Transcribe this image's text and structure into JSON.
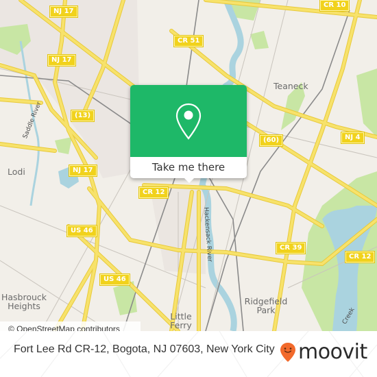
{
  "map": {
    "road_shields": [
      {
        "id": "nj17-top",
        "label": "NJ 17"
      },
      {
        "id": "nj17-mid",
        "label": "NJ 17"
      },
      {
        "id": "cr51",
        "label": "CR 51"
      },
      {
        "id": "cr10",
        "label": "CR 10"
      },
      {
        "id": "r13",
        "label": "(13)"
      },
      {
        "id": "r60",
        "label": "(60)"
      },
      {
        "id": "nj4",
        "label": "NJ 4"
      },
      {
        "id": "nj17-low",
        "label": "NJ 17"
      },
      {
        "id": "cr12-left",
        "label": "CR 12"
      },
      {
        "id": "us46-top",
        "label": "US 46"
      },
      {
        "id": "cr39",
        "label": "CR 39"
      },
      {
        "id": "cr12-right",
        "label": "CR 12"
      },
      {
        "id": "us46-bottom",
        "label": "US 46"
      }
    ],
    "places": {
      "teaneck": "Teaneck",
      "lodi": "Lodi",
      "hasbrouck_heights": "Hasbrouck\nHeights",
      "ridgefield_park": "Ridgefield\nPark",
      "little_ferry": "Little\nFerry"
    },
    "rivers": {
      "saddle_river": "Saddle River",
      "hackensack_river": "Hackensack River",
      "creek": "Creek"
    },
    "colors": {
      "land": "#f2efe9",
      "road": "#f7e26b",
      "road_outline": "#e8c93a",
      "water": "#aad3df",
      "park": "#c8e6a4",
      "popup_green": "#1eb868",
      "moovit_orange": "#f26a2c"
    }
  },
  "popup": {
    "icon": "map-pin-icon",
    "action_label": "Take me there"
  },
  "attribution": "© OpenStreetMap contributors",
  "footer": {
    "address": "Fort Lee Rd CR-12, Bogota, NJ 07603, New York City",
    "brand": "moovit"
  }
}
